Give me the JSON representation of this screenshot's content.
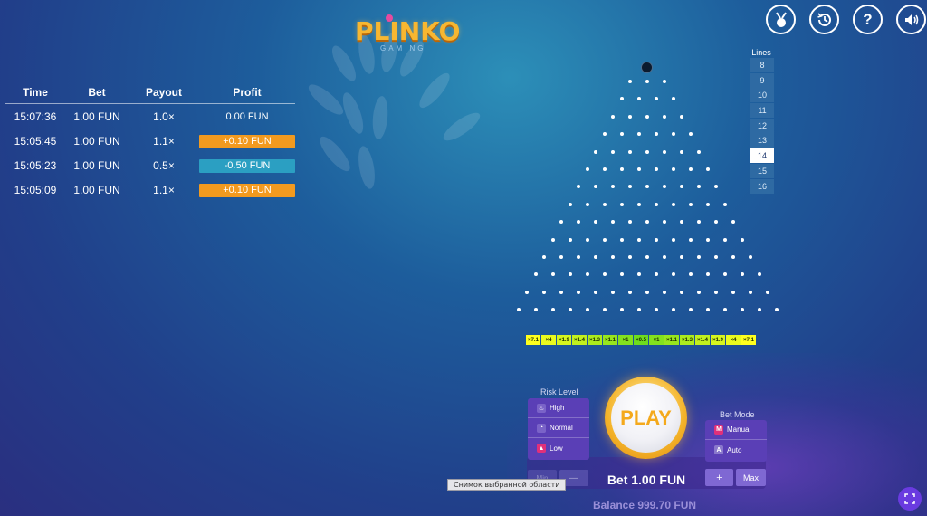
{
  "logo": {
    "title": "PLINKO",
    "subtitle": "GAMING"
  },
  "top_icons": [
    "medal-icon",
    "history-icon",
    "help-icon",
    "sound-icon"
  ],
  "history": {
    "headers": {
      "time": "Time",
      "bet": "Bet",
      "payout": "Payout",
      "profit": "Profit"
    },
    "rows": [
      {
        "time": "15:07:36",
        "bet": "1.00 FUN",
        "payout": "1.0×",
        "profit": "0.00 FUN",
        "status": "none"
      },
      {
        "time": "15:05:45",
        "bet": "1.00 FUN",
        "payout": "1.1×",
        "profit": "+0.10 FUN",
        "status": "gain"
      },
      {
        "time": "15:05:23",
        "bet": "1.00 FUN",
        "payout": "0.5×",
        "profit": "-0.50 FUN",
        "status": "loss"
      },
      {
        "time": "15:05:09",
        "bet": "1.00 FUN",
        "payout": "1.1×",
        "profit": "+0.10 FUN",
        "status": "gain"
      }
    ]
  },
  "lines": {
    "label": "Lines",
    "options": [
      "8",
      "9",
      "10",
      "11",
      "12",
      "13",
      "14",
      "15",
      "16"
    ],
    "selected": "14"
  },
  "multipliers": [
    "×7.1",
    "×4",
    "×1.9",
    "×1.4",
    "×1.3",
    "×1.1",
    "×1",
    "×0.5",
    "×1",
    "×1.1",
    "×1.3",
    "×1.4",
    "×1.9",
    "×4",
    "×7.1"
  ],
  "risk": {
    "label": "Risk Level",
    "options": [
      {
        "label": "High",
        "icon": "fire-icon",
        "active": false
      },
      {
        "label": "Normal",
        "icon": "gauge-icon",
        "active": false
      },
      {
        "label": "Low",
        "icon": "drop-icon",
        "active": true
      }
    ]
  },
  "play_label": "PLAY",
  "bet_mode": {
    "label": "Bet Mode",
    "options": [
      {
        "label": "Manual",
        "key": "M",
        "active": true
      },
      {
        "label": "Auto",
        "key": "A",
        "active": false
      }
    ]
  },
  "bet": {
    "min_label": "Min",
    "minus_label": "—",
    "plus_label": "+",
    "max_label": "Max",
    "text": "Bet 1.00 FUN"
  },
  "balance": "Balance 999.70 FUN",
  "tooltip": "Снимок выбранной области",
  "colors": {
    "gain": "#f29a1f",
    "loss": "#2b9fc2",
    "play_accent": "#f4a91c",
    "panel": "#5a3fb6"
  }
}
